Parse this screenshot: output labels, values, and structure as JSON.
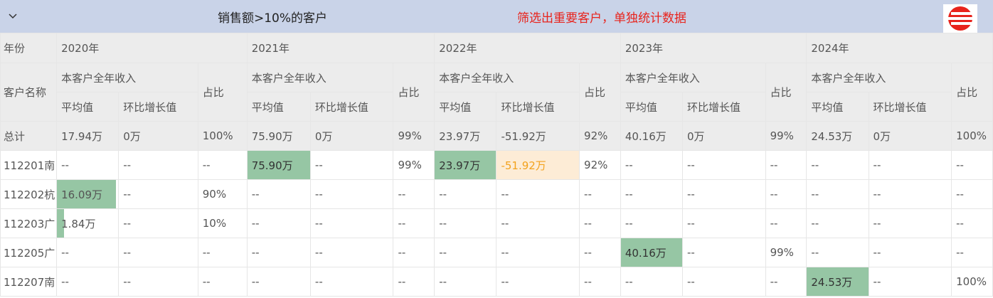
{
  "header": {
    "title": "销售额>10%的客户",
    "note": "筛选出重要客户，单独统计数据"
  },
  "table": {
    "row_header_label": "年份",
    "name_header_label": "客户名称",
    "years": [
      "2020年",
      "2021年",
      "2022年",
      "2023年",
      "2024年"
    ],
    "group_label": "本客户全年收入",
    "avg_label": "平均值",
    "growth_label": "环比增长值",
    "share_label": "占比",
    "total": {
      "label": "总计",
      "cells": [
        [
          "17.94万",
          "0万",
          "100%"
        ],
        [
          "75.90万",
          "0万",
          "99%"
        ],
        [
          "23.97万",
          "-51.92万",
          "92%"
        ],
        [
          "40.16万",
          "0万",
          "99%"
        ],
        [
          "24.53万",
          "0万",
          "100%"
        ]
      ]
    },
    "rows": [
      {
        "name": "112201南",
        "cells": [
          [
            "--",
            "--",
            "--"
          ],
          [
            "75.90万",
            "--",
            "99%"
          ],
          [
            "23.97万",
            "-51.92万",
            "92%"
          ],
          [
            "--",
            "--",
            "--"
          ],
          [
            "--",
            "--",
            "--"
          ]
        ]
      },
      {
        "name": "112202杭",
        "cells": [
          [
            "16.09万",
            "--",
            "90%"
          ],
          [
            "--",
            "--",
            "--"
          ],
          [
            "--",
            "--",
            "--"
          ],
          [
            "--",
            "--",
            "--"
          ],
          [
            "--",
            "--",
            "--"
          ]
        ]
      },
      {
        "name": "112203广",
        "cells": [
          [
            "1.84万",
            "--",
            "10%"
          ],
          [
            "--",
            "--",
            "--"
          ],
          [
            "--",
            "--",
            "--"
          ],
          [
            "--",
            "--",
            "--"
          ],
          [
            "--",
            "--",
            "--"
          ]
        ]
      },
      {
        "name": "112205广",
        "cells": [
          [
            "--",
            "--",
            "--"
          ],
          [
            "--",
            "--",
            "--"
          ],
          [
            "--",
            "--",
            "--"
          ],
          [
            "40.16万",
            "--",
            "99%"
          ],
          [
            "--",
            "--",
            "--"
          ]
        ]
      },
      {
        "name": "112207南",
        "cells": [
          [
            "--",
            "--",
            "--"
          ],
          [
            "--",
            "--",
            "--"
          ],
          [
            "--",
            "--",
            "--"
          ],
          [
            "--",
            "--",
            "--"
          ],
          [
            "24.53万",
            "--",
            "100%"
          ]
        ]
      }
    ]
  },
  "highlights": [
    {
      "row": 0,
      "year": 1,
      "col": 0,
      "type": "green"
    },
    {
      "row": 0,
      "year": 2,
      "col": 0,
      "type": "green"
    },
    {
      "row": 0,
      "year": 2,
      "col": 1,
      "type": "orange"
    },
    {
      "row": 1,
      "year": 0,
      "col": 0,
      "type": "bar",
      "fill": 0.96
    },
    {
      "row": 2,
      "year": 0,
      "col": 0,
      "type": "bar",
      "fill": 0.11
    },
    {
      "row": 3,
      "year": 3,
      "col": 0,
      "type": "green"
    },
    {
      "row": 4,
      "year": 4,
      "col": 0,
      "type": "green"
    }
  ],
  "colors": {
    "header_bg": "#c9d3e8",
    "note_text": "#e8231c",
    "highlight_green": "#96c6a4",
    "highlight_orange_bg": "#fdecd6",
    "highlight_orange_text": "#f3a21d"
  },
  "icons": {
    "collapse": "chevron-down-icon",
    "logo": "logo-icon"
  }
}
